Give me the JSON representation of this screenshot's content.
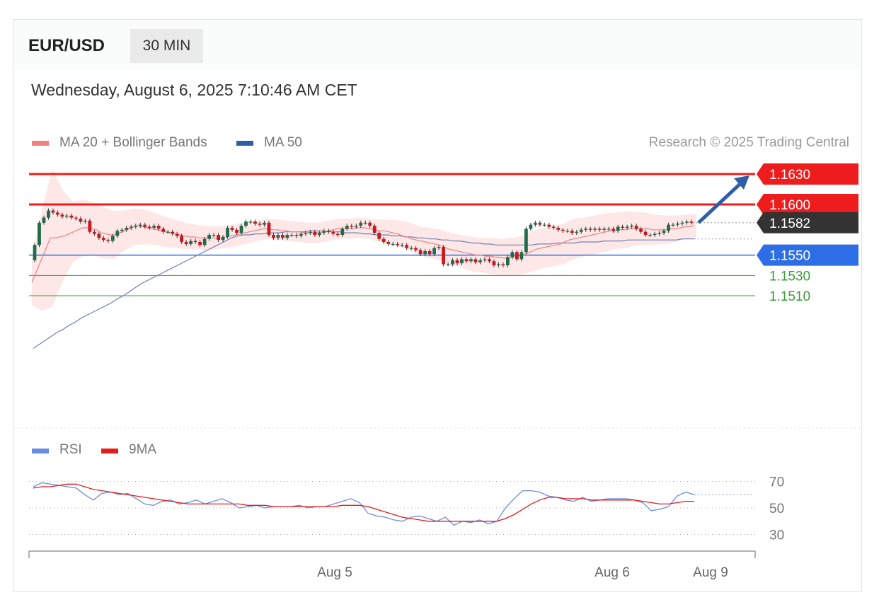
{
  "header": {
    "symbol": "EUR/USD",
    "timeframe": "30 MIN",
    "datetime": "Wednesday, August 6, 2025 7:10:46 AM CET"
  },
  "legend": {
    "ma20_label": "MA 20 + Bollinger Bands",
    "ma50_label": "MA 50",
    "rsi_label": "RSI",
    "ma9_label": "9MA",
    "copyright": "Research © 2025 Trading Central"
  },
  "colors": {
    "resistance": "#ee1c1c",
    "support": "#2d6ee6",
    "minor_support": "#3c9a3c",
    "current": "#333333",
    "ma20": "#f08080",
    "band_fill": "#fde3e3",
    "ma50": "#6b82b8",
    "candle_up": "#1f6b4a",
    "candle_down": "#c8181e",
    "rsi": "#6a8de0",
    "rsi_ma": "#e51c1c",
    "arrow": "#2d5ea6"
  },
  "chart_data": [
    {
      "type": "candlestick",
      "title": "EUR/USD 30 MIN",
      "x_ticks": [
        "Aug 5",
        "Aug 6",
        "Aug 9"
      ],
      "price_levels": [
        {
          "value": 1.163,
          "label": "1.1630",
          "kind": "resistance"
        },
        {
          "value": 1.16,
          "label": "1.1600",
          "kind": "resistance"
        },
        {
          "value": 1.1582,
          "label": "1.1582",
          "kind": "current"
        },
        {
          "value": 1.155,
          "label": "1.1550",
          "kind": "support"
        },
        {
          "value": 1.153,
          "label": "1.1530",
          "kind": "minor_support"
        },
        {
          "value": 1.151,
          "label": "1.1510",
          "kind": "minor_support"
        }
      ],
      "forecast": {
        "direction": "up",
        "from": 1.1582,
        "to": 1.163
      },
      "close": [
        1.156,
        1.1582,
        1.1587,
        1.1594,
        1.1592,
        1.159,
        1.1588,
        1.1589,
        1.1587,
        1.1586,
        1.1583,
        1.1584,
        1.1573,
        1.1571,
        1.1567,
        1.1565,
        1.1564,
        1.1569,
        1.1574,
        1.1575,
        1.1577,
        1.1578,
        1.1579,
        1.158,
        1.1578,
        1.1577,
        1.1579,
        1.1576,
        1.1573,
        1.1573,
        1.1571,
        1.1569,
        1.1563,
        1.1561,
        1.1564,
        1.1563,
        1.156,
        1.1566,
        1.157,
        1.157,
        1.1565,
        1.1568,
        1.1577,
        1.1575,
        1.1572,
        1.1579,
        1.1583,
        1.1583,
        1.1581,
        1.158,
        1.1582,
        1.157,
        1.1567,
        1.157,
        1.1567,
        1.157,
        1.157,
        1.1569,
        1.1571,
        1.1572,
        1.1573,
        1.157,
        1.1572,
        1.1574,
        1.1573,
        1.1571,
        1.157,
        1.1576,
        1.1579,
        1.1578,
        1.1579,
        1.1582,
        1.1582,
        1.1579,
        1.1572,
        1.1566,
        1.1563,
        1.1561,
        1.1561,
        1.156,
        1.156,
        1.1557,
        1.1557,
        1.1555,
        1.1551,
        1.1554,
        1.1551,
        1.1557,
        1.1558,
        1.1541,
        1.1541,
        1.1545,
        1.1542,
        1.1546,
        1.1544,
        1.1546,
        1.1543,
        1.1545,
        1.1546,
        1.1544,
        1.154,
        1.1541,
        1.154,
        1.1548,
        1.1553,
        1.1546,
        1.1553,
        1.1576,
        1.158,
        1.1582,
        1.158,
        1.158,
        1.1578,
        1.1577,
        1.1575,
        1.1574,
        1.1574,
        1.1572,
        1.1573,
        1.1575,
        1.1576,
        1.1575,
        1.1576,
        1.1575,
        1.1576,
        1.1576,
        1.1574,
        1.1578,
        1.1577,
        1.1578,
        1.1579,
        1.1576,
        1.1573,
        1.157,
        1.157,
        1.1571,
        1.1572,
        1.1574,
        1.158,
        1.158,
        1.1581,
        1.1582,
        1.1583,
        1.1582
      ],
      "ma20": [
        1.1523,
        1.1534,
        1.1545,
        1.1556,
        1.1567,
        1.1567,
        1.1568,
        1.1569,
        1.1571,
        1.1573,
        1.1575,
        1.1577,
        1.1577,
        1.1576,
        1.1575,
        1.1572,
        1.1571,
        1.157,
        1.157,
        1.1572,
        1.1574,
        1.1576,
        1.1578,
        1.1579,
        1.1578,
        1.1577,
        1.1576,
        1.1575,
        1.1574,
        1.1573,
        1.1572,
        1.1571,
        1.157,
        1.1569,
        1.1568,
        1.1568,
        1.1567,
        1.1567,
        1.1567,
        1.1567,
        1.1567,
        1.1567,
        1.1568,
        1.1569,
        1.157,
        1.1571,
        1.1572,
        1.1573,
        1.1574,
        1.1575,
        1.1576,
        1.1576,
        1.1575,
        1.1575,
        1.1574,
        1.1574,
        1.1573,
        1.1573,
        1.1573,
        1.1572,
        1.1572,
        1.1572,
        1.1572,
        1.1573,
        1.1574,
        1.1575,
        1.1576,
        1.1576,
        1.1576,
        1.1576,
        1.1577,
        1.1577,
        1.1577,
        1.1576,
        1.1575,
        1.1574,
        1.1574,
        1.1573,
        1.1572,
        1.1571,
        1.1569,
        1.1568,
        1.1566,
        1.1565,
        1.1564,
        1.1563,
        1.1562,
        1.1561,
        1.156,
        1.1558,
        1.1556,
        1.1555,
        1.1554,
        1.1553,
        1.1552,
        1.1551,
        1.155,
        1.155,
        1.1549,
        1.1549,
        1.1548,
        1.1548,
        1.1547,
        1.1548,
        1.1548,
        1.1549,
        1.155,
        1.1552,
        1.1554,
        1.1556,
        1.1557,
        1.1558,
        1.1559,
        1.156,
        1.1561,
        1.1563,
        1.1565,
        1.1566,
        1.1567,
        1.1568,
        1.1569,
        1.157,
        1.1571,
        1.1572,
        1.1573,
        1.1574,
        1.1574,
        1.1575,
        1.1575,
        1.1576,
        1.1576,
        1.1576,
        1.1576,
        1.1576,
        1.1575,
        1.1575,
        1.1575,
        1.1575,
        1.1576,
        1.1576,
        1.1577,
        1.1578,
        1.1578,
        1.1579
      ],
      "ma50": [
        1.1458,
        1.1462,
        1.1466,
        1.147,
        1.1474,
        1.1477,
        1.1481,
        1.1484,
        1.1488,
        1.1491,
        1.1494,
        1.1497,
        1.15,
        1.1503,
        1.1507,
        1.151,
        1.1514,
        1.1518,
        1.1522,
        1.1525,
        1.1528,
        1.1531,
        1.1534,
        1.1537,
        1.154,
        1.1543,
        1.1546,
        1.1549,
        1.1552,
        1.1555,
        1.1558,
        1.1561,
        1.1564,
        1.1567,
        1.1569,
        1.157,
        1.157,
        1.1571,
        1.1571,
        1.1572,
        1.1572,
        1.1572,
        1.1573,
        1.1573,
        1.1573,
        1.1573,
        1.1574,
        1.1574,
        1.1574,
        1.1573,
        1.1573,
        1.1573,
        1.1572,
        1.1572,
        1.1572,
        1.1571,
        1.1571,
        1.157,
        1.157,
        1.157,
        1.1569,
        1.1569,
        1.1568,
        1.1568,
        1.1567,
        1.1567,
        1.1566,
        1.1566,
        1.1565,
        1.1565,
        1.1564,
        1.1564,
        1.1563,
        1.1562,
        1.1562,
        1.1561,
        1.1561,
        1.156,
        1.156,
        1.156,
        1.156,
        1.156,
        1.156,
        1.156,
        1.1561,
        1.1561,
        1.1561,
        1.1562,
        1.1562,
        1.1562,
        1.1562,
        1.1563,
        1.1563,
        1.1563,
        1.1563,
        1.1564,
        1.1564,
        1.1564,
        1.1564,
        1.1565,
        1.1565,
        1.1565,
        1.1565,
        1.1565,
        1.1565,
        1.1565,
        1.1565,
        1.1565,
        1.1566,
        1.1566,
        1.1566
      ],
      "bollinger_half_width": [
        0.0022,
        0.005,
        0.0068,
        0.0045,
        0.003,
        0.0028,
        0.0026,
        0.0025,
        0.0024,
        0.002,
        0.0018,
        0.0017,
        0.0016,
        0.0015,
        0.0014,
        0.0013,
        0.0012,
        0.0012,
        0.0011,
        0.0011,
        0.0011,
        0.0011,
        0.001,
        0.001,
        0.001,
        0.001,
        0.001,
        0.001,
        0.001,
        0.001,
        0.001,
        0.001,
        0.001,
        0.001,
        0.0011,
        0.0012,
        0.0013,
        0.0014,
        0.0014,
        0.0015,
        0.0015,
        0.0016,
        0.0016,
        0.0017,
        0.0017,
        0.0018,
        0.0018,
        0.0019,
        0.0019,
        0.002,
        0.002,
        0.002,
        0.002,
        0.002,
        0.0019,
        0.0019,
        0.0019,
        0.0018,
        0.0018,
        0.0017,
        0.0016,
        0.0015,
        0.0014,
        0.0013,
        0.0012,
        0.0012
      ]
    },
    {
      "type": "line",
      "title": "RSI",
      "y_ticks": [
        70,
        50,
        30
      ],
      "series": [
        {
          "name": "RSI",
          "values": [
            66,
            69,
            68,
            67,
            66,
            65,
            60,
            56,
            61,
            62,
            60,
            61,
            57,
            53,
            52,
            55,
            56,
            53,
            54,
            56,
            53,
            55,
            57,
            54,
            50,
            51,
            52,
            50,
            51,
            51,
            51,
            52,
            50,
            51,
            51,
            53,
            55,
            57,
            54,
            46,
            44,
            43,
            41,
            40,
            43,
            44,
            42,
            40,
            43,
            37,
            40,
            39,
            41,
            38,
            40,
            50,
            57,
            63,
            63,
            62,
            59,
            58,
            56,
            55,
            58,
            55,
            56,
            57,
            57,
            57,
            56,
            54,
            48,
            49,
            51,
            59,
            62,
            60
          ]
        },
        {
          "name": "9MA",
          "values": [
            65,
            66,
            66,
            67,
            68,
            68,
            66,
            64,
            63,
            62,
            61,
            60,
            59,
            58,
            57,
            56,
            55,
            54,
            53,
            53,
            53,
            53,
            53,
            53,
            53,
            52,
            52,
            52,
            51,
            51,
            51,
            51,
            51,
            51,
            51,
            51,
            52,
            52,
            52,
            51,
            49,
            47,
            45,
            43,
            42,
            41,
            40,
            40,
            40,
            40,
            40,
            40,
            40,
            40,
            40,
            42,
            45,
            49,
            53,
            56,
            58,
            58,
            57,
            57,
            57,
            56,
            56,
            56,
            56,
            56,
            56,
            55,
            54,
            53,
            53,
            54,
            55,
            55
          ]
        }
      ]
    }
  ]
}
